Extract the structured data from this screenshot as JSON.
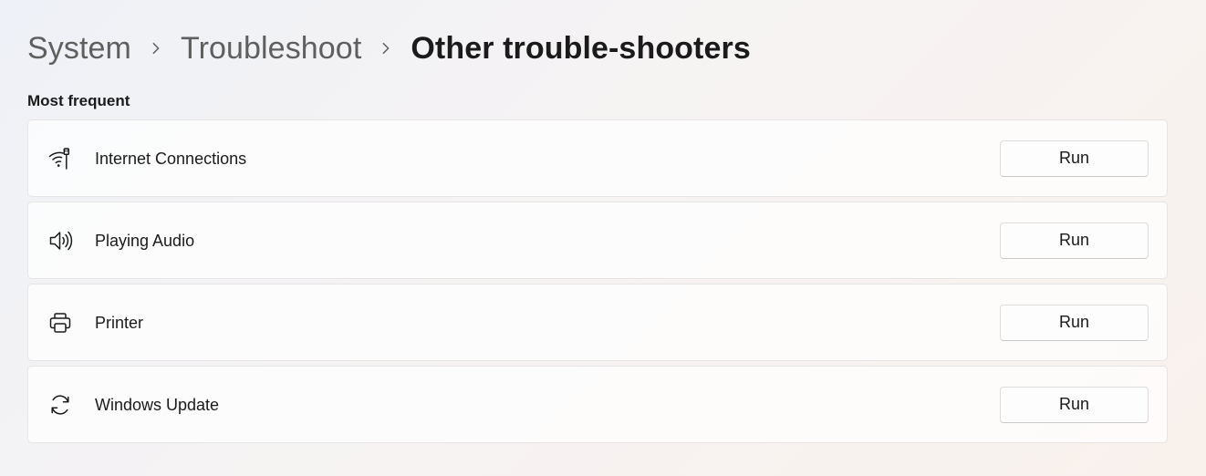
{
  "breadcrumb": {
    "items": [
      {
        "label": "System"
      },
      {
        "label": "Troubleshoot"
      },
      {
        "label": "Other trouble-shooters"
      }
    ]
  },
  "section": {
    "title": "Most frequent"
  },
  "troubleshooters": [
    {
      "label": "Internet Connections",
      "icon": "wifi-ethernet-icon",
      "button": "Run"
    },
    {
      "label": "Playing Audio",
      "icon": "speaker-icon",
      "button": "Run"
    },
    {
      "label": "Printer",
      "icon": "printer-icon",
      "button": "Run"
    },
    {
      "label": "Windows Update",
      "icon": "sync-icon",
      "button": "Run"
    }
  ],
  "colors": {
    "text_primary": "#1b1b1b",
    "text_secondary": "#5f5f5f",
    "card_border": "#e6e4e4",
    "button_border": "#dcdcdc"
  }
}
